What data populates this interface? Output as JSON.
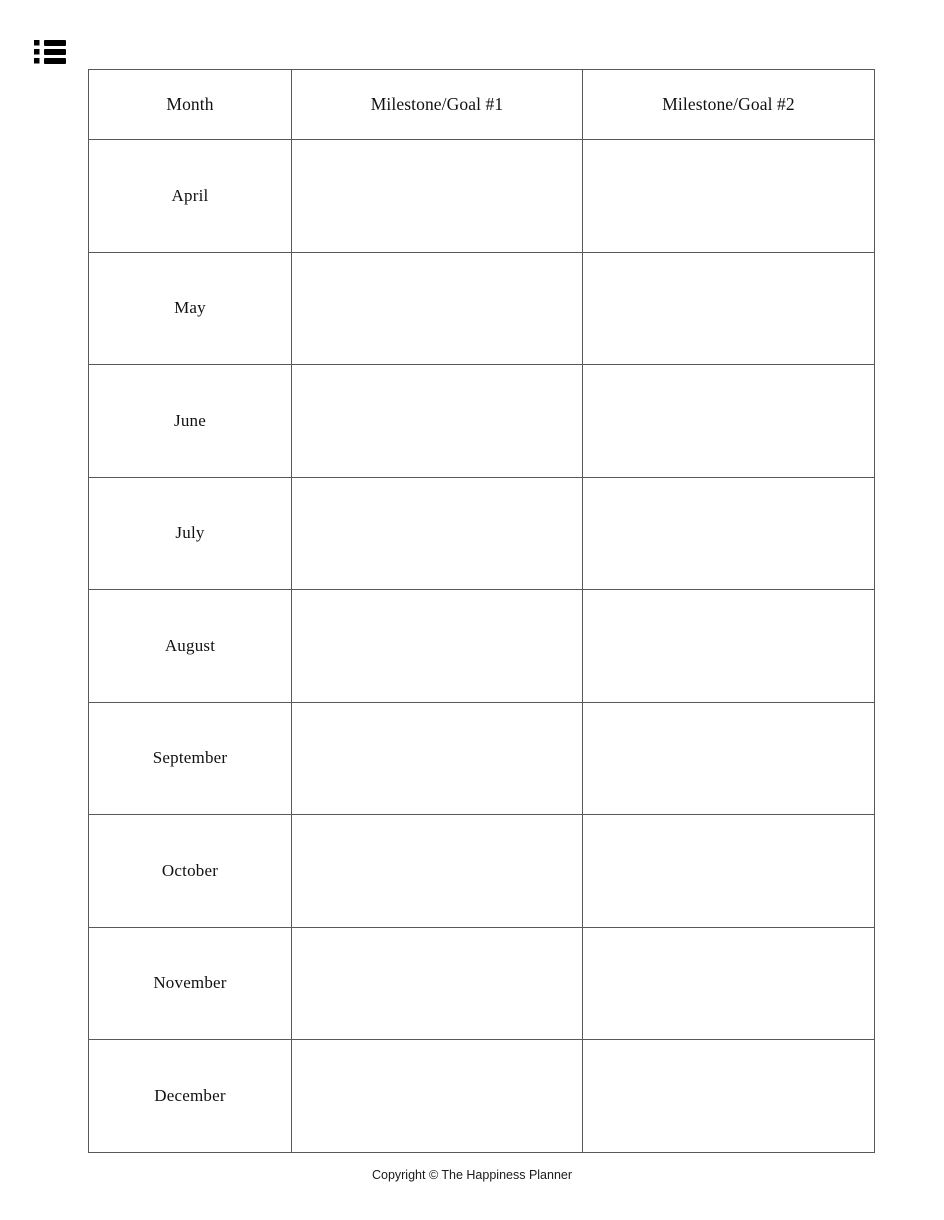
{
  "toolbar": {
    "list_icon": "bulleted-list-icon"
  },
  "table": {
    "headers": [
      "Month",
      "Milestone/Goal #1",
      "Milestone/Goal #2"
    ],
    "rows": [
      {
        "month": "April",
        "goal1": "",
        "goal2": ""
      },
      {
        "month": "May",
        "goal1": "",
        "goal2": ""
      },
      {
        "month": "June",
        "goal1": "",
        "goal2": ""
      },
      {
        "month": "July",
        "goal1": "",
        "goal2": ""
      },
      {
        "month": "August",
        "goal1": "",
        "goal2": ""
      },
      {
        "month": "September",
        "goal1": "",
        "goal2": ""
      },
      {
        "month": "October",
        "goal1": "",
        "goal2": ""
      },
      {
        "month": "November",
        "goal1": "",
        "goal2": ""
      },
      {
        "month": "December",
        "goal1": "",
        "goal2": ""
      }
    ]
  },
  "footer": {
    "copyright": "Copyright © The Happiness Planner"
  },
  "colors": {
    "border": "#58595b",
    "text": "#111111",
    "background": "#ffffff"
  }
}
